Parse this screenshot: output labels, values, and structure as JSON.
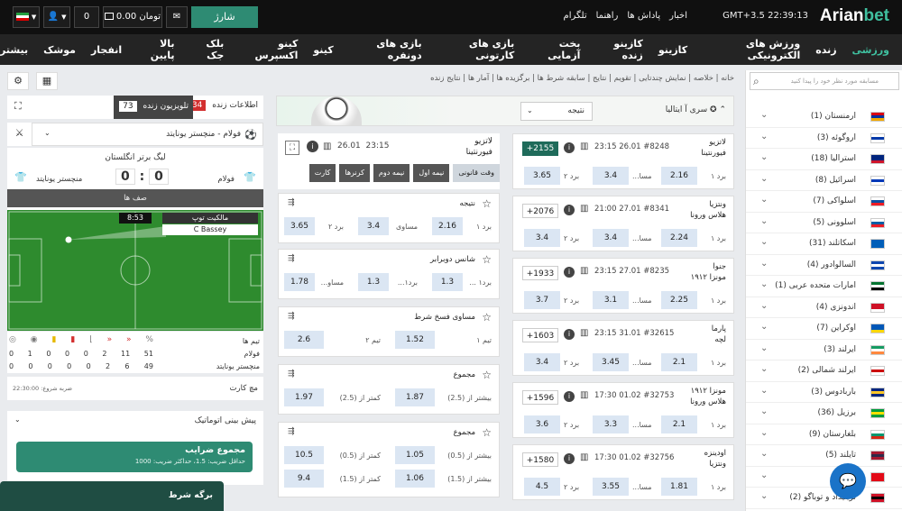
{
  "header": {
    "logo_prefix": "Arian",
    "logo_suffix": "bet",
    "time": "22:39:13",
    "timezone": "GMT+3.5",
    "links": [
      "اخبار",
      "پاداش ها",
      "راهنما",
      "تلگرام"
    ],
    "charge_label": "شارژ",
    "balance": "0.00 تومان",
    "bonus_balance": "0"
  },
  "nav": {
    "items": [
      "ورزشی",
      "زنده",
      "ورزش های الکترونیکی",
      "کازینو",
      "کازینو زنده",
      "بخت آزمایی",
      "بازی های کارتونی",
      "بازی های دونفره",
      "کینو",
      "کینو اکسپرس",
      "بلک جک",
      "بالا پایین",
      "انفجار",
      "موشک",
      "بیشتر"
    ]
  },
  "search": {
    "placeholder": "مسابقه مورد نظر خود را پیدا کنید"
  },
  "countries": [
    {
      "name": "ارمنستان (1)",
      "flag": [
        "#d90012",
        "#0033a0",
        "#f2a800"
      ]
    },
    {
      "name": "اروگوئه (3)",
      "flag": [
        "#ffffff",
        "#0038a8",
        "#ffffff"
      ]
    },
    {
      "name": "استرالیا (18)",
      "flag": [
        "#00247d",
        "#00247d",
        "#cf142b"
      ]
    },
    {
      "name": "اسرائیل (8)",
      "flag": [
        "#ffffff",
        "#0038b8",
        "#ffffff"
      ]
    },
    {
      "name": "اسلواکی (7)",
      "flag": [
        "#ffffff",
        "#0b4ea2",
        "#ee1c25"
      ]
    },
    {
      "name": "اسلوونی (5)",
      "flag": [
        "#ffffff",
        "#005da4",
        "#ed1c24"
      ]
    },
    {
      "name": "اسکاتلند (31)",
      "flag": [
        "#005eb8",
        "#005eb8",
        "#005eb8"
      ]
    },
    {
      "name": "السالوادور (4)",
      "flag": [
        "#0f47af",
        "#ffffff",
        "#0f47af"
      ]
    },
    {
      "name": "امارات متحده عربی (1)",
      "flag": [
        "#00732f",
        "#ffffff",
        "#000000"
      ]
    },
    {
      "name": "اندونزی (4)",
      "flag": [
        "#ce1126",
        "#ce1126",
        "#ffffff"
      ]
    },
    {
      "name": "اوکراین (7)",
      "flag": [
        "#0057b7",
        "#0057b7",
        "#ffd700"
      ]
    },
    {
      "name": "ایرلند (3)",
      "flag": [
        "#169b62",
        "#ffffff",
        "#ff883e"
      ]
    },
    {
      "name": "ایرلند شمالی (2)",
      "flag": [
        "#ffffff",
        "#cc0000",
        "#ffffff"
      ]
    },
    {
      "name": "باربادوس (3)",
      "flag": [
        "#00267f",
        "#ffc726",
        "#00267f"
      ]
    },
    {
      "name": "برزیل (36)",
      "flag": [
        "#009c3b",
        "#ffdf00",
        "#009c3b"
      ]
    },
    {
      "name": "بلغارستان (9)",
      "flag": [
        "#ffffff",
        "#00966e",
        "#d62612"
      ]
    },
    {
      "name": "تایلند (5)",
      "flag": [
        "#a51931",
        "#2d2a4a",
        "#a51931"
      ]
    },
    {
      "name": "(14)",
      "flag": [
        "#e30a17",
        "#e30a17",
        "#e30a17"
      ]
    },
    {
      "name": "ترینیداد و توباگو (2)",
      "flag": [
        "#ce1126",
        "#000000",
        "#ce1126"
      ]
    }
  ],
  "breadcrumbs": [
    "خانه",
    "خلاصه",
    "نمایش چندتایی",
    "تقویم",
    "نتایج",
    "سابقه شرط ها",
    "برگزیده ها",
    "آمار ها",
    "نتایج زنده"
  ],
  "league_bar": {
    "league": "سری آ ایتالیا",
    "market_select": "نتیجه"
  },
  "matches": [
    {
      "home": "لاتزیو",
      "away": "فیورنتینا",
      "id": "#8248",
      "date": "26.01",
      "time": "23:15",
      "markets": "+2155",
      "o1": "2.16",
      "ox": "3.4",
      "o2": "3.65",
      "highlight": true
    },
    {
      "home": "ونتزیا",
      "away": "هلاس ورونا",
      "id": "#8341",
      "date": "27.01",
      "time": "21:00",
      "markets": "+2076",
      "o1": "2.24",
      "ox": "3.4",
      "o2": "3.4",
      "highlight": false
    },
    {
      "home": "جنوا",
      "away": "مونزا ۱۹۱۲",
      "id": "#8235",
      "date": "27.01",
      "time": "23:15",
      "markets": "+1933",
      "o1": "2.25",
      "ox": "3.1",
      "o2": "3.7",
      "highlight": false
    },
    {
      "home": "پارما",
      "away": "لچه",
      "id": "#32615",
      "date": "31.01",
      "time": "23:15",
      "markets": "+1603",
      "o1": "2.1",
      "ox": "3.45",
      "o2": "3.4",
      "highlight": false
    },
    {
      "home": "مونزا ۱۹۱۲",
      "away": "هلاس ورونا",
      "id": "#32753",
      "date": "01.02",
      "time": "17:30",
      "markets": "+1596",
      "o1": "2.1",
      "ox": "3.3",
      "o2": "3.6",
      "highlight": false
    },
    {
      "home": "اودینزه",
      "away": "ونتزیا",
      "id": "#32756",
      "date": "01.02",
      "time": "17:30",
      "markets": "+1580",
      "o1": "1.81",
      "ox": "3.55",
      "o2": "4.5",
      "highlight": false
    }
  ],
  "odds_labels": {
    "one": "برد ۱",
    "draw": "مسا...",
    "two": "برد ۲",
    "draw_full": "مساوی"
  },
  "detail": {
    "home": "لاتزیو",
    "away": "فیورنتینا",
    "date": "26.01",
    "time": "23:15",
    "tabs": [
      "وقت قانونی",
      "نیمه اول",
      "نیمه دوم",
      "کرنرها",
      "کارت"
    ],
    "markets": [
      {
        "title": "نتیجه",
        "outcomes": [
          [
            "برد ۱",
            "2.16"
          ],
          [
            "مساوی",
            "3.4"
          ],
          [
            "برد ۲",
            "3.65"
          ]
        ]
      },
      {
        "title": "شانس دوبرابر",
        "outcomes": [
          [
            "برد۱ ...",
            "1.3"
          ],
          [
            "برد۱...",
            "1.3"
          ],
          [
            "مساو...",
            "1.78"
          ]
        ]
      },
      {
        "title": "مساوی فسخ شرط",
        "outcomes": [
          [
            "تیم ۱",
            "1.52"
          ],
          [
            "تیم ۲",
            "2.6"
          ]
        ]
      },
      {
        "title": "مجموع",
        "outcomes": [
          [
            "بیشتر از (2.5)",
            "1.87"
          ],
          [
            "کمتر از (2.5)",
            "1.97"
          ]
        ]
      },
      {
        "title": "مجموع",
        "outcomes": [
          [
            "بیشتر از (0.5)",
            "1.05"
          ],
          [
            "کمتر از (0.5)",
            "10.5"
          ]
        ],
        "outcomes2": [
          [
            "بیشتر از (1.5)",
            "1.06"
          ],
          [
            "کمتر از (1.5)",
            "9.4"
          ]
        ]
      }
    ]
  },
  "live": {
    "info_label": "اطلاعات زنده",
    "info_count": "134",
    "tv_label": "تلویزیون زنده",
    "tv_count": "73",
    "selected_match": "فولام - منچستر یونایتد",
    "league": "لیگ برتر انگلستان",
    "home_team": "فولام",
    "away_team": "منچستر یونایتد",
    "home_score": "0",
    "away_score": "0",
    "phase": "صف ها",
    "minute": "8:53",
    "event_title": "مالکیت توپ",
    "event_player": "C Bassey",
    "stats_header": "تیم ها",
    "home_stats": [
      "0",
      "1",
      "0",
      "0",
      "0",
      "2",
      "11",
      "51"
    ],
    "away_stats": [
      "0",
      "0",
      "0",
      "0",
      "0",
      "2",
      "6",
      "49"
    ],
    "card_label": "مچ کارت",
    "start_label": "ضربه شروع",
    "start_time": "22:30:00"
  },
  "autoforecast": {
    "title": "پیش بینی اتوماتیک",
    "card_title": "مجموع ضرایب",
    "card_sub": "حداقل ضریب: 1.5، حداکثر ضریب: 1000"
  },
  "betslip": {
    "label": "برگه شرط"
  },
  "colors": {
    "brand": "#3fbf9f",
    "header": "#101010",
    "nav": "#242424",
    "odds_bg": "#dbe6f3",
    "pitch": "#2e8b2e"
  }
}
